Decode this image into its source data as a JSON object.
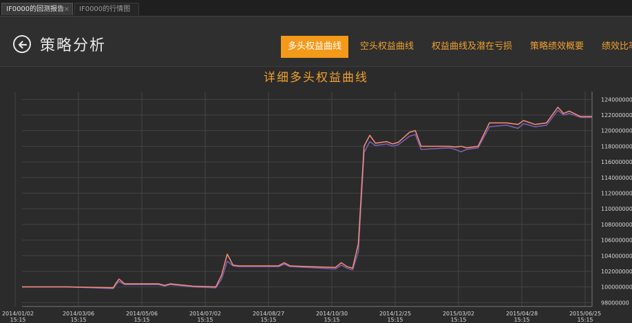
{
  "doc_tabs": [
    {
      "label": "IF0000的回测报告",
      "close": "×"
    },
    {
      "label": "IF0000的行情图"
    }
  ],
  "header": {
    "title": "策略分析",
    "nav_tabs": [
      "多头权益曲线",
      "空头权益曲线",
      "权益曲线及潜在亏损",
      "策略绩效概要",
      "绩效比率"
    ]
  },
  "chart_data": {
    "type": "line",
    "title": "详细多头权益曲线",
    "y_ticks": [
      "124000000",
      "122000000",
      "120000000",
      "118000000",
      "116000000",
      "114000000",
      "112000000",
      "110000000",
      "108000000",
      "106000000",
      "104000000",
      "102000000",
      "100000000",
      "98000000"
    ],
    "x_ticks": [
      {
        "date": "2014/01/02",
        "time": "15:15"
      },
      {
        "date": "2014/03/06",
        "time": "15:15"
      },
      {
        "date": "2014/05/06",
        "time": "15:15"
      },
      {
        "date": "2014/07/02",
        "time": "15:15"
      },
      {
        "date": "2014/08/27",
        "time": "15:15"
      },
      {
        "date": "2014/10/30",
        "time": "15:15"
      },
      {
        "date": "2014/12/25",
        "time": "15:15"
      },
      {
        "date": "2015/03/02",
        "time": "15:15"
      },
      {
        "date": "2015/04/28",
        "time": "15:15"
      },
      {
        "date": "2015/06/25",
        "time": "15:15"
      }
    ],
    "ylim": [
      97500000,
      125000000
    ],
    "grid": true,
    "series": [
      {
        "color": "#f08878",
        "x": [
          0,
          0.08,
          0.16,
          0.165,
          0.17,
          0.18,
          0.24,
          0.25,
          0.26,
          0.3,
          0.34,
          0.35,
          0.36,
          0.37,
          0.38,
          0.4,
          0.45,
          0.46,
          0.47,
          0.5,
          0.55,
          0.56,
          0.57,
          0.58,
          0.59,
          0.6,
          0.61,
          0.62,
          0.64,
          0.65,
          0.66,
          0.68,
          0.69,
          0.7,
          0.75,
          0.76,
          0.77,
          0.78,
          0.8,
          0.82,
          0.85,
          0.87,
          0.88,
          0.9,
          0.92,
          0.94,
          0.95,
          0.96,
          0.98,
          1.0
        ],
        "y": [
          100000000,
          100000000,
          99900000,
          100500000,
          101000000,
          100400000,
          100400000,
          100200000,
          100400000,
          100100000,
          100000000,
          101500000,
          104200000,
          102800000,
          102700000,
          102700000,
          102700000,
          103100000,
          102700000,
          102600000,
          102500000,
          103100000,
          102600000,
          102400000,
          105500000,
          118000000,
          119400000,
          118400000,
          118600000,
          118300000,
          118500000,
          119800000,
          120000000,
          118000000,
          118000000,
          117900000,
          118000000,
          117800000,
          118000000,
          121000000,
          121000000,
          120800000,
          121300000,
          120800000,
          121000000,
          123000000,
          122200000,
          122500000,
          121800000,
          121800000
        ]
      },
      {
        "color": "#7a5fb0",
        "x": [
          0,
          0.08,
          0.16,
          0.165,
          0.17,
          0.18,
          0.24,
          0.25,
          0.26,
          0.3,
          0.34,
          0.35,
          0.36,
          0.37,
          0.38,
          0.4,
          0.45,
          0.46,
          0.47,
          0.5,
          0.55,
          0.56,
          0.57,
          0.58,
          0.59,
          0.6,
          0.61,
          0.62,
          0.64,
          0.65,
          0.66,
          0.68,
          0.69,
          0.7,
          0.75,
          0.76,
          0.77,
          0.78,
          0.8,
          0.82,
          0.85,
          0.87,
          0.88,
          0.9,
          0.92,
          0.94,
          0.95,
          0.96,
          0.98,
          1.0
        ],
        "y": [
          100000000,
          100000000,
          99800000,
          100300000,
          100700000,
          100300000,
          100300000,
          100100000,
          100300000,
          100000000,
          99900000,
          101000000,
          103300000,
          102700000,
          102600000,
          102600000,
          102600000,
          102900000,
          102600000,
          102500000,
          102300000,
          102800000,
          102400000,
          102200000,
          104500000,
          117200000,
          118600000,
          118100000,
          118300000,
          118000000,
          118200000,
          119300000,
          119500000,
          117600000,
          117800000,
          117600000,
          117300000,
          117600000,
          117800000,
          120500000,
          120700000,
          120300000,
          120900000,
          120500000,
          120700000,
          122600000,
          122000000,
          122200000,
          121700000,
          121700000
        ]
      }
    ]
  }
}
